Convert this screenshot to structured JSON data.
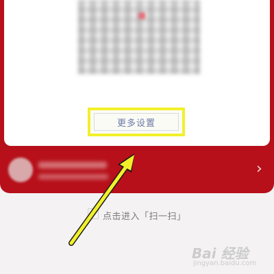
{
  "card": {
    "more_settings_label": "更多设置"
  },
  "user": {
    "chevron": "›"
  },
  "scan": {
    "label": "点击进入「扫一扫」"
  },
  "watermark": {
    "brand": "Bai 经验",
    "sub": "jingyan.baidu.com"
  },
  "colors": {
    "red": "#b7101a",
    "highlight": "#f2f02a",
    "link": "#6b7aa6"
  }
}
